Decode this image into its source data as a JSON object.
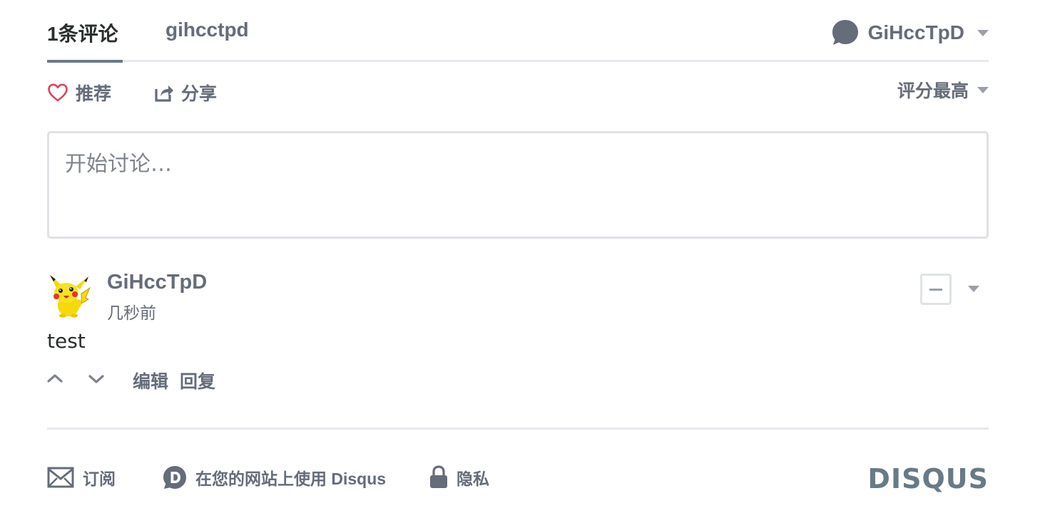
{
  "nav": {
    "comment_count_tab": "1条评论",
    "forum_tab": "gihcctpd",
    "user_name": "GiHccTpD"
  },
  "actions": {
    "recommend_label": "推荐",
    "share_label": "分享",
    "sort_label": "评分最高"
  },
  "composer": {
    "placeholder": "开始讨论…"
  },
  "comments": [
    {
      "author": "GiHccTpD",
      "time": "几秒前",
      "body": "test",
      "edit_label": "编辑",
      "reply_label": "回复"
    }
  ],
  "footer": {
    "subscribe_label": "订阅",
    "add_disqus_label": "在您的网站上使用 Disqus",
    "privacy_label": "隐私",
    "logo_text": "DISQUS"
  },
  "colors": {
    "muted_text": "#656c7a",
    "body_text": "#2a2e2e",
    "divider": "#e7e9ee",
    "heart": "#e0445a",
    "logo": "#687a86"
  }
}
